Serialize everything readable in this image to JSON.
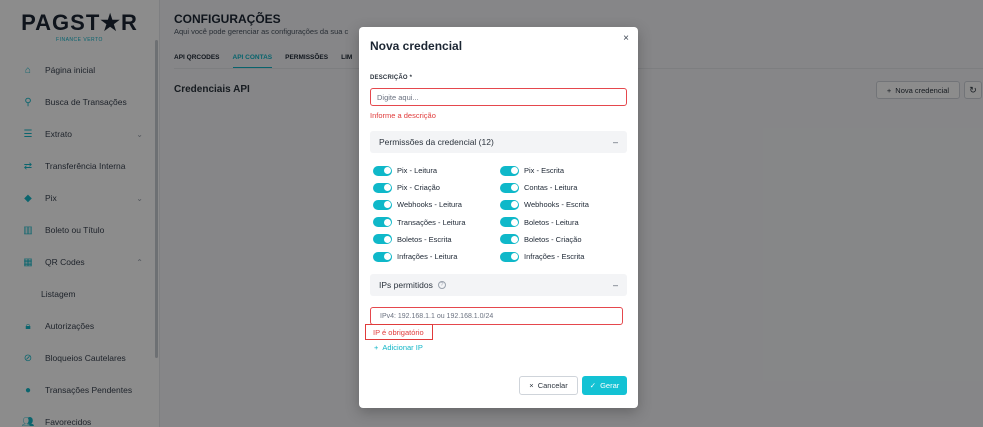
{
  "brand": {
    "name_part1": "PAGST",
    "name_star": "★",
    "name_part2": "R",
    "tagline": "FINANCE VERTO"
  },
  "sidebar": {
    "items": [
      {
        "label": "Página inicial",
        "icon": "home-icon"
      },
      {
        "label": "Busca de Transações",
        "icon": "search-icon"
      },
      {
        "label": "Extrato",
        "icon": "list-icon",
        "chevron": "⌄"
      },
      {
        "label": "Transferência Interna",
        "icon": "transfer-icon"
      },
      {
        "label": "Pix",
        "icon": "pix-icon",
        "chevron": "⌄"
      },
      {
        "label": "Boleto ou Título",
        "icon": "barcode-icon"
      },
      {
        "label": "QR Codes",
        "icon": "qrcode-icon",
        "chevron": "⌃"
      },
      {
        "label": "Listagem"
      },
      {
        "label": "Autorizações",
        "icon": "lock-icon"
      },
      {
        "label": "Bloqueios Cautelares",
        "icon": "block-icon"
      },
      {
        "label": "Transações Pendentes",
        "icon": "clock-icon"
      },
      {
        "label": "Favorecidos",
        "icon": "users-icon"
      }
    ]
  },
  "header": {
    "title": "CONFIGURAÇÕES",
    "subtitle": "Aqui você pode gerenciar as configurações da sua c"
  },
  "tabs": [
    {
      "label": "API QRCODES"
    },
    {
      "label": "API CONTAS"
    },
    {
      "label": "PERMISSÕES"
    },
    {
      "label": "LIM"
    }
  ],
  "content": {
    "section_title": "Credenciais API",
    "new_button": "Nova credencial",
    "new_button_icon": "+",
    "refresh_icon": "↻"
  },
  "modal": {
    "title": "Nova credencial",
    "close": "×",
    "description_label": "DESCRIÇÃO *",
    "description_placeholder": "Digite aqui...",
    "description_value": "",
    "description_error": "Informe a descrição",
    "permissions_title": "Permissões da credencial (12)",
    "permissions_collapse": "–",
    "permissions": [
      "Pix - Leitura",
      "Pix - Escrita",
      "Pix - Criação",
      "Contas - Leitura",
      "Webhooks - Leitura",
      "Webhooks - Escrita",
      "Transações - Leitura",
      "Boletos - Leitura",
      "Boletos - Escrita",
      "Boletos - Criação",
      "Infrações - Leitura",
      "Infrações - Escrita"
    ],
    "ips_title": "IPs permitidos",
    "ips_help": "?",
    "ips_collapse": "–",
    "ip_placeholder": "IPv4: 192.168.1.1 ou 192.168.1.0/24",
    "ip_error": "IP é obrigatório",
    "add_ip_icon": "+",
    "add_ip": "Adicionar IP",
    "cancel_icon": "×",
    "cancel": "Cancelar",
    "submit_icon": "✓",
    "submit": "Gerar"
  },
  "colors": {
    "accent": "#10b5c6",
    "error": "#e03b3b",
    "overlay": "rgba(0,0,0,0.45)"
  }
}
